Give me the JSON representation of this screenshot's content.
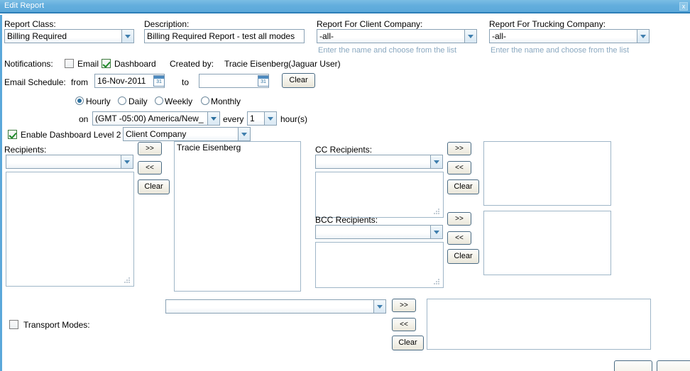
{
  "window": {
    "title": "Edit Report",
    "close_label": "x"
  },
  "form": {
    "report_class": {
      "label": "Report Class:",
      "value": "Billing Required"
    },
    "description": {
      "label": "Description:",
      "value": "Billing Required Report - test all modes"
    },
    "client_company": {
      "label": "Report For Client Company:",
      "value": "-all-",
      "hint": "Enter the name and choose from the list"
    },
    "trucking_company": {
      "label": "Report For Trucking Company:",
      "value": "-all-",
      "hint": "Enter the name and choose from the list"
    },
    "notifications": {
      "label": "Notifications:",
      "email_label": "Email",
      "email_checked": false,
      "dashboard_label": "Dashboard",
      "dashboard_checked": true
    },
    "created_by": {
      "label": "Created by:",
      "value": "Tracie Eisenberg(Jaguar User)"
    },
    "email_schedule": {
      "label": "Email Schedule:",
      "from_label": "from",
      "from_value": "16-Nov-2011",
      "to_label": "to",
      "to_value": "",
      "clear_label": "Clear",
      "frequency": {
        "hourly": "Hourly",
        "daily": "Daily",
        "weekly": "Weekly",
        "monthly": "Monthly",
        "selected": "Hourly"
      },
      "on_label": "on",
      "timezone_value": "(GMT -05:00) America/New_",
      "every_label": "every",
      "every_value": "1",
      "hours_label": "hour(s)"
    },
    "dashboard_level2": {
      "label": "Enable Dashboard Level 2",
      "checked": true,
      "grouping_value": "Client Company"
    },
    "recipients": {
      "label": "Recipients:",
      "select_value": "",
      "textarea_value": "",
      "add_label": ">>",
      "remove_label": "<<",
      "clear_label": "Clear",
      "selected_items": [
        "Tracie Eisenberg"
      ]
    },
    "cc_recipients": {
      "label": "CC Recipients:",
      "select_value": "",
      "textarea_value": "",
      "add_label": ">>",
      "remove_label": "<<",
      "clear_label": "Clear",
      "selected_items": []
    },
    "bcc_recipients": {
      "label": "BCC Recipients:",
      "select_value": "",
      "textarea_value": "",
      "add_label": ">>",
      "remove_label": "<<",
      "clear_label": "Clear",
      "selected_items": []
    },
    "transport_modes": {
      "label": "Transport Modes:",
      "checked": false,
      "select_value": "",
      "add_label": ">>",
      "remove_label": "<<",
      "clear_label": "Clear",
      "selected_items": []
    }
  },
  "colors": {
    "titlebar": "#63aedd",
    "titlebar_border": "#2d7fb8",
    "hint_text": "#8aa8c0",
    "field_border": "#8aa2b5",
    "check_green": "#1f8a28"
  }
}
